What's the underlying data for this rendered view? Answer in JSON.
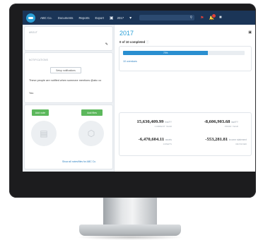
{
  "navbar": {
    "brand": "ABC Co.",
    "items": [
      "Documents",
      "Reports",
      "Export"
    ],
    "year_icon": "calendar-icon",
    "year": "2017",
    "search_icon": "search-icon",
    "icons": [
      "flag-icon",
      "bell-icon",
      "user-icon"
    ]
  },
  "left": {
    "about_label": "About",
    "notifications_label": "Notifications",
    "setup_button": "Setup notifications",
    "notify_text": "These people are notified when someone mentions @abc co",
    "notify_you": "You",
    "add_note_button": "Add note",
    "add_file_button": "Add files",
    "more_link": "Show all notes/files for ABC Co."
  },
  "right": {
    "title": "2017",
    "progress_text": "0 of 10 completed",
    "progress_percent": 0.7,
    "progress_bar_label": "70%",
    "done_link": "10 overdues",
    "stats": [
      {
        "value": "15,630,409.99",
        "unit": "this/FY",
        "label": "CURRENT YEAR"
      },
      {
        "value": "-8,606,903.68",
        "unit": "last/FY",
        "label": "PRIOR YEAR"
      },
      {
        "value": "-6,470,604.11",
        "unit": "assets",
        "label": "ASSETS"
      },
      {
        "value": "-553,281.81",
        "unit": "income statement",
        "label": "RETAINED"
      }
    ]
  },
  "colors": {
    "navbar": "#1b3557",
    "accent": "#2a9fd6",
    "green": "#5cb85c",
    "progress": "#2a8fd0"
  }
}
